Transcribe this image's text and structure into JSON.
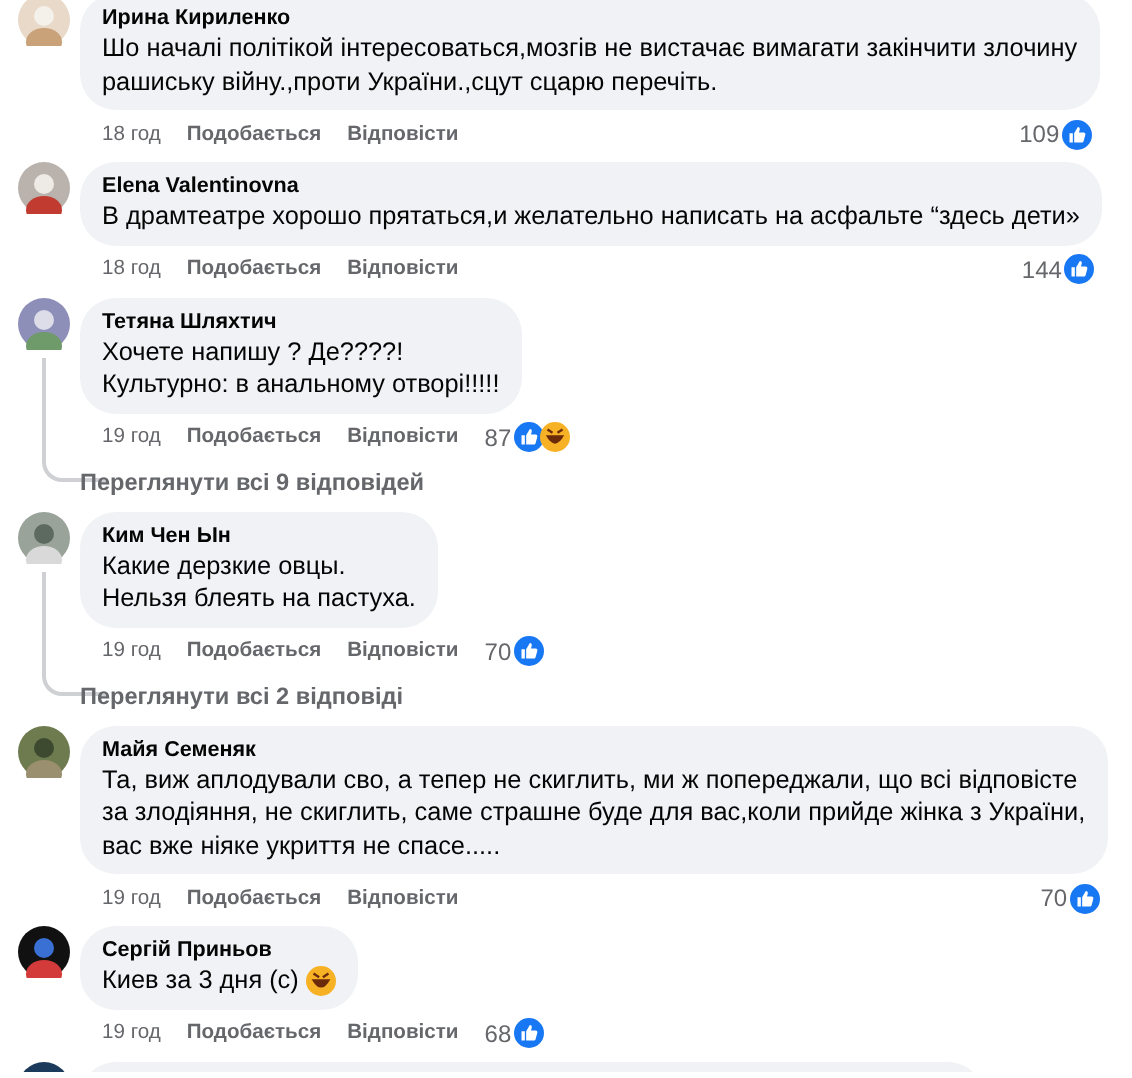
{
  "comments": [
    {
      "kind": "comment",
      "author": "Ирина Кириленко",
      "lines": [
        "Шо началі політікой інтересоваться,мозгів не вистачає вимагати закінчити злочину",
        "рашиську війну.,проти України.,сцут сцарю перечіть."
      ],
      "time": "18 год",
      "like": "Подобається",
      "reply": "Відповісти",
      "count": "109",
      "reactions": [
        {
          "kind": "like"
        }
      ]
    },
    {
      "kind": "comment",
      "author": "Elena Valentinovna",
      "lines": [
        "В драмтеатре хорошо прятаться,и желательно написать на асфальте “здесь дети»"
      ],
      "time": "18 год",
      "like": "Подобається",
      "reply": "Відповісти",
      "count": "144",
      "reactions": [
        {
          "kind": "like"
        }
      ]
    },
    {
      "kind": "comment",
      "author": "Тетяна Шляхтич",
      "lines": [
        "Хочете напишу ? Де????!",
        "Культурно: в анальному отворі!!!!!"
      ],
      "time": "19 год",
      "like": "Подобається",
      "reply": "Відповісти",
      "count": "87",
      "reactions": [
        {
          "kind": "like"
        },
        {
          "kind": "haha"
        }
      ],
      "replies_link": "Переглянути всі 9 відповідей"
    },
    {
      "kind": "comment",
      "author": "Ким Чен Ын",
      "lines": [
        "Какие дерзкие овцы.",
        "Нельзя блеять на пастуха."
      ],
      "time": "19 год",
      "like": "Подобається",
      "reply": "Відповісти",
      "count": "70",
      "reactions": [
        {
          "kind": "like"
        }
      ],
      "replies_link": "Переглянути всі 2 відповіді"
    },
    {
      "kind": "comment",
      "author": "Майя Семеняк",
      "lines": [
        "Та, виж аплодували сво, а тепер не скиглить, ми ж попереджали, що всі відповісте",
        "за злодіяння, не скиглить, саме страшне буде для вас,коли прийде жінка з України,",
        "вас вже ніяке укриття не спасе....."
      ],
      "time": "19 год",
      "like": "Подобається",
      "reply": "Відповісти",
      "count": "70",
      "reactions": [
        {
          "kind": "like"
        }
      ]
    },
    {
      "kind": "comment",
      "author": "Сергій Приньов",
      "lines": [
        "Киев за 3 дня (с)"
      ],
      "trailing_emoji": {
        "kind": "haha"
      },
      "time": "19 год",
      "like": "Подобається",
      "reply": "Відповісти",
      "count": "68",
      "reactions": [
        {
          "kind": "like"
        }
      ]
    },
    {
      "kind": "cutoff"
    }
  ]
}
